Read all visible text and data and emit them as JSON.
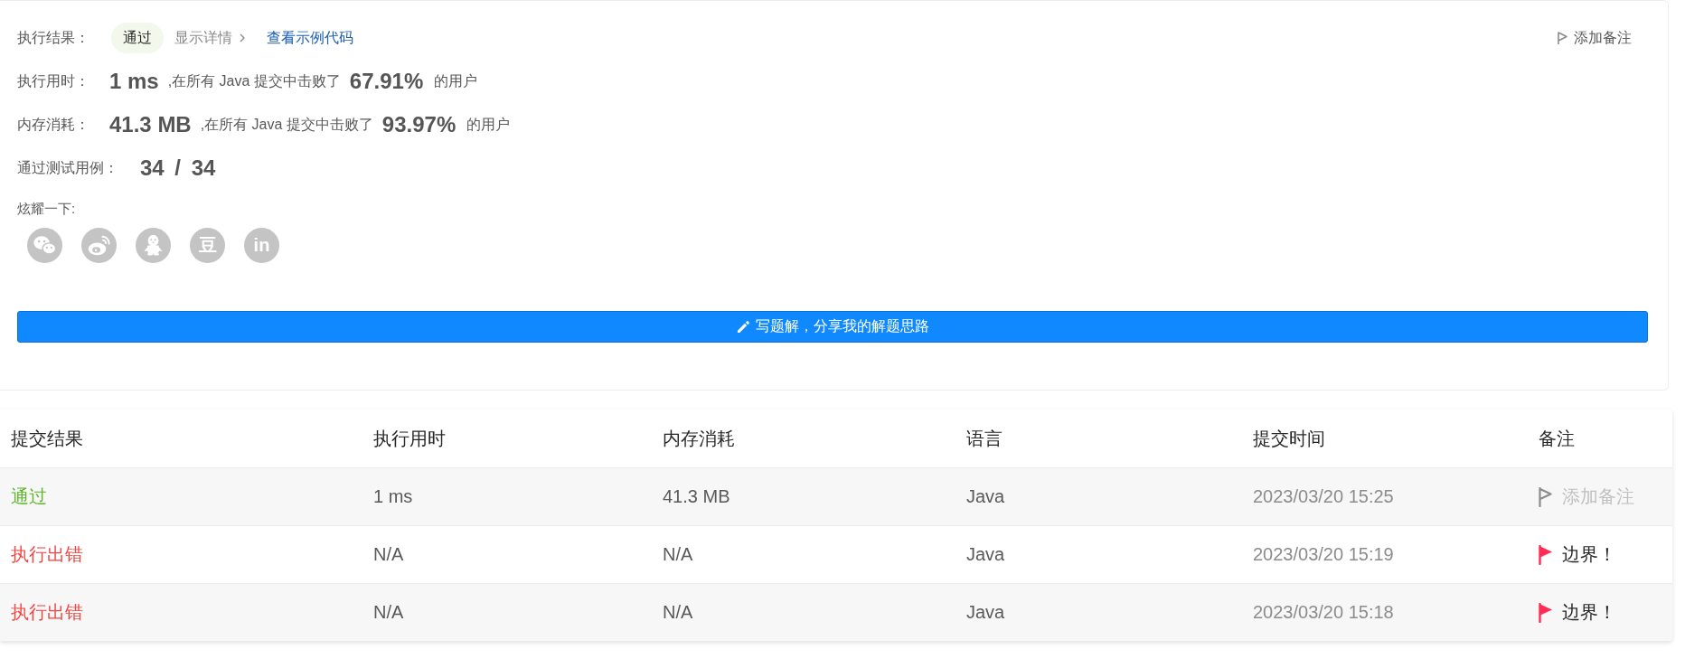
{
  "result": {
    "label": "执行结果：",
    "status": {
      "text": "通过",
      "kind": "accepted"
    },
    "details_link": "显示详情",
    "example_link": "查看示例代码"
  },
  "add_note_button": "添加备注",
  "stats": [
    {
      "label": "执行用时：",
      "value": "1 ms",
      "comparison": ",在所有 Java 提交中击败了",
      "percent": "67.91%",
      "suffix": "的用户"
    },
    {
      "label": "内存消耗：",
      "value": "41.3 MB",
      "comparison": ",在所有 Java 提交中击败了",
      "percent": "93.97%",
      "suffix": "的用户"
    }
  ],
  "test_cases": {
    "label": "通过测试用例：",
    "value": "34 / 34"
  },
  "share": {
    "label": "炫耀一下:",
    "buttons": [
      {
        "kind": "chat"
      },
      {
        "kind": "swirl"
      },
      {
        "kind": "penguin"
      },
      {
        "kind": "glyph",
        "text": "豆"
      },
      {
        "kind": "glyph",
        "text": "in"
      }
    ]
  },
  "write_solution_button": "写题解，分享我的解题思路",
  "submissions": {
    "columns": [
      "提交结果",
      "执行用时",
      "内存消耗",
      "语言",
      "提交时间",
      "备注"
    ],
    "rows": [
      {
        "status": {
          "text": "通过",
          "kind": "accepted"
        },
        "runtime": "1 ms",
        "memory": "41.3 MB",
        "language": "Java",
        "submitted_at": "2023/03/20 15:25",
        "note": {
          "text": "添加备注",
          "flagged": false
        }
      },
      {
        "status": {
          "text": "执行出错",
          "kind": "error"
        },
        "runtime": "N/A",
        "memory": "N/A",
        "language": "Java",
        "submitted_at": "2023/03/20 15:19",
        "note": {
          "text": "边界！",
          "flagged": true
        }
      },
      {
        "status": {
          "text": "执行出错",
          "kind": "error"
        },
        "runtime": "N/A",
        "memory": "N/A",
        "language": "Java",
        "submitted_at": "2023/03/20 15:18",
        "note": {
          "text": "边界！",
          "flagged": true
        }
      }
    ]
  }
}
